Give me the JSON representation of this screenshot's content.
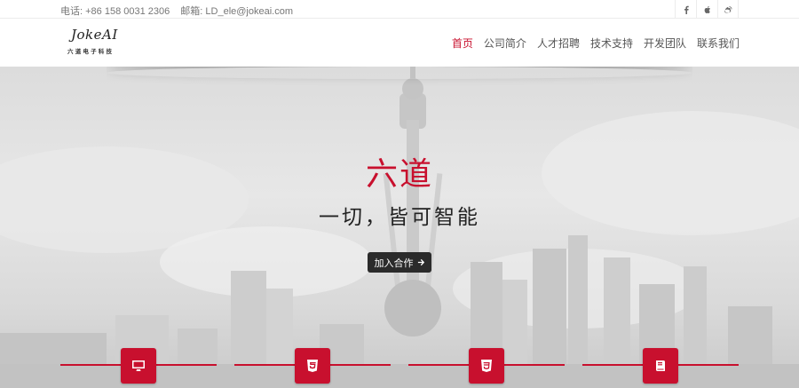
{
  "topbar": {
    "phone": "电话: +86 158 0031 2306",
    "email": "邮箱: LD_ele@jokeai.com",
    "social_icons": [
      "facebook-icon",
      "apple-icon",
      "weibo-icon"
    ]
  },
  "logo": {
    "main": "JokeAI",
    "sub": "六道电子科技"
  },
  "nav": {
    "items": [
      {
        "label": "首页",
        "active": true
      },
      {
        "label": "公司简介",
        "active": false
      },
      {
        "label": "人才招聘",
        "active": false
      },
      {
        "label": "技术支持",
        "active": false
      },
      {
        "label": "开发团队",
        "active": false
      },
      {
        "label": "联系我们",
        "active": false
      }
    ]
  },
  "hero": {
    "title": "六道",
    "subtitle": "一切，皆可智能",
    "button_label": "加入合作",
    "button_icon": "arrow-right-icon"
  },
  "features": {
    "icons": [
      "monitor-icon",
      "html5-icon",
      "css3-icon",
      "book-icon"
    ]
  },
  "colors": {
    "accent": "#c8102e",
    "button_bg": "#2b2b2b"
  }
}
